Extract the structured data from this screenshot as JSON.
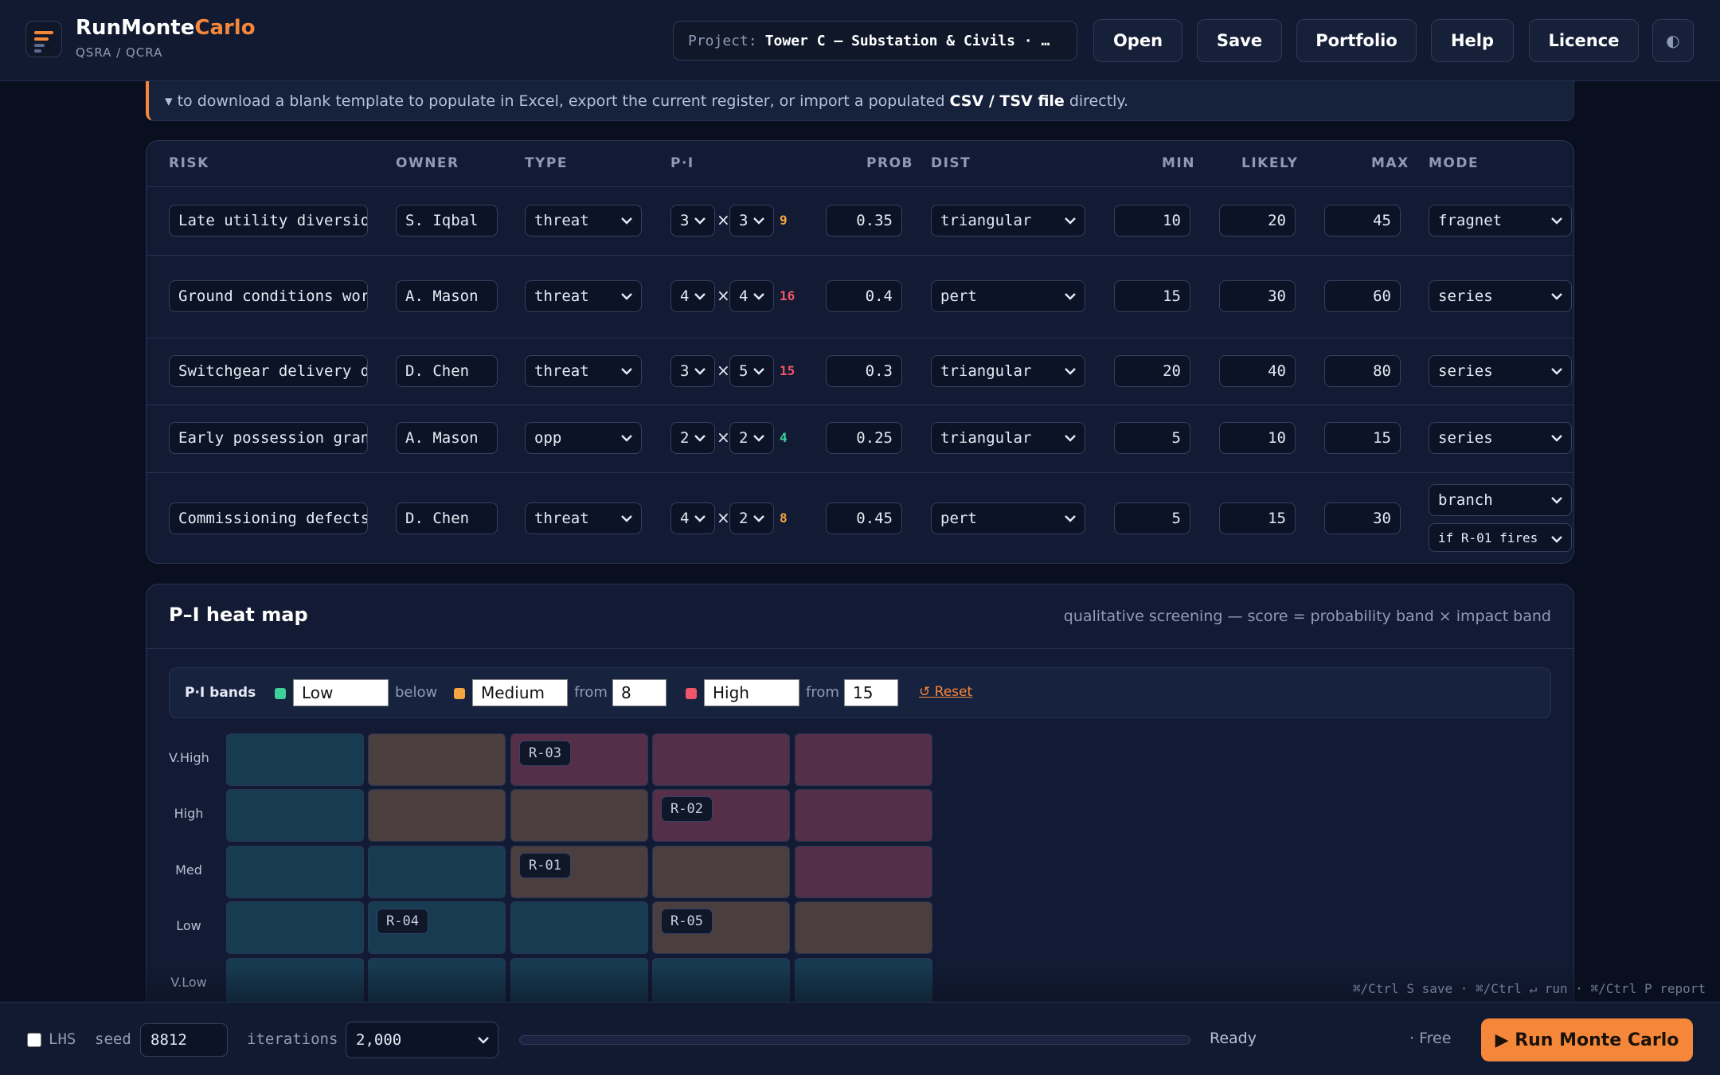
{
  "header": {
    "brand_main": "RunMonte",
    "brand_accent": "Carlo",
    "brand_sub": "QSRA / QCRA",
    "project_label": "Project:",
    "project_value": "Tower C — Substation & Civils · …",
    "buttons": {
      "open": "Open",
      "save": "Save",
      "portfolio": "Portfolio",
      "help": "Help",
      "licence": "Licence",
      "theme": "◐"
    }
  },
  "note": {
    "prefix": "▾ to download a blank template to populate in Excel, export the current register, or import a populated",
    "bold": "CSV / TSV file",
    "suffix": "directly."
  },
  "register": {
    "columns": {
      "risk": "RISK",
      "owner": "OWNER",
      "type": "TYPE",
      "pi": "P·I",
      "prob": "PROB",
      "dist": "DIST",
      "min": "MIN",
      "likely": "LIKELY",
      "max": "MAX",
      "mode": "MODE"
    },
    "rows": [
      {
        "risk": "Late utility diversion",
        "owner": "S. Iqbal",
        "type": "threat",
        "p": "3",
        "i": "3",
        "score": "9",
        "prob": "0.35",
        "dist": "triangular",
        "min": "10",
        "likely": "20",
        "max": "45",
        "mode": "fragnet",
        "condition": ""
      },
      {
        "risk": "Ground conditions worse than survey",
        "owner": "A. Mason",
        "type": "threat",
        "p": "4",
        "i": "4",
        "score": "16",
        "prob": "0.4",
        "dist": "pert",
        "min": "15",
        "likely": "30",
        "max": "60",
        "mode": "series",
        "condition": ""
      },
      {
        "risk": "Switchgear delivery delay",
        "owner": "D. Chen",
        "type": "threat",
        "p": "3",
        "i": "5",
        "score": "15",
        "prob": "0.3",
        "dist": "triangular",
        "min": "20",
        "likely": "40",
        "max": "80",
        "mode": "series",
        "condition": ""
      },
      {
        "risk": "Early possession granted",
        "owner": "A. Mason",
        "type": "opp",
        "p": "2",
        "i": "2",
        "score": "4",
        "prob": "0.25",
        "dist": "triangular",
        "min": "5",
        "likely": "10",
        "max": "15",
        "mode": "series",
        "condition": ""
      },
      {
        "risk": "Commissioning defects",
        "owner": "D. Chen",
        "type": "threat",
        "p": "4",
        "i": "2",
        "score": "8",
        "prob": "0.45",
        "dist": "pert",
        "min": "5",
        "likely": "15",
        "max": "30",
        "mode": "branch",
        "condition": "if R-01 fires"
      }
    ]
  },
  "heatmap": {
    "title": "P–I heat map",
    "subtitle": "qualitative screening — score = probability band × impact band",
    "bands_title": "P·I bands",
    "bands": [
      {
        "name": "Low",
        "label": "below",
        "threshold": "",
        "color": "#3fcf9a"
      },
      {
        "name": "Medium",
        "label": "from",
        "threshold": "8",
        "color": "#f5a640"
      },
      {
        "name": "High",
        "label": "from",
        "threshold": "15",
        "color": "#f0566a"
      }
    ],
    "reset": "↺ Reset",
    "row_labels": [
      "V.High",
      "High",
      "Med",
      "Low",
      "V.Low"
    ],
    "colors": {
      "low": "#173c52",
      "medium": "#4a3e3e",
      "high": "#552e48"
    },
    "grid": [
      [
        "low",
        "medium",
        "high",
        "high",
        "high"
      ],
      [
        "low",
        "medium",
        "medium",
        "high",
        "high"
      ],
      [
        "low",
        "low",
        "medium",
        "medium",
        "high"
      ],
      [
        "low",
        "low",
        "low",
        "medium",
        "medium"
      ],
      [
        "low",
        "low",
        "low",
        "low",
        "low"
      ]
    ],
    "markers": [
      {
        "id": "R-03",
        "row": 0,
        "col": 2
      },
      {
        "id": "R-02",
        "row": 1,
        "col": 3
      },
      {
        "id": "R-01",
        "row": 2,
        "col": 2
      },
      {
        "id": "R-04",
        "row": 3,
        "col": 1
      },
      {
        "id": "R-05",
        "row": 3,
        "col": 3
      }
    ]
  },
  "hints": "⌘/Ctrl S save · ⌘/Ctrl ↵ run · ⌘/Ctrl P report",
  "footer": {
    "lhs_label": "LHS",
    "seed_label": "seed",
    "seed_value": "8812",
    "iterations_label": "iterations",
    "iterations_value": "2,000",
    "progress": 0,
    "status": "Ready",
    "plan": "· Free",
    "run_label": "▶ Run Monte Carlo"
  }
}
